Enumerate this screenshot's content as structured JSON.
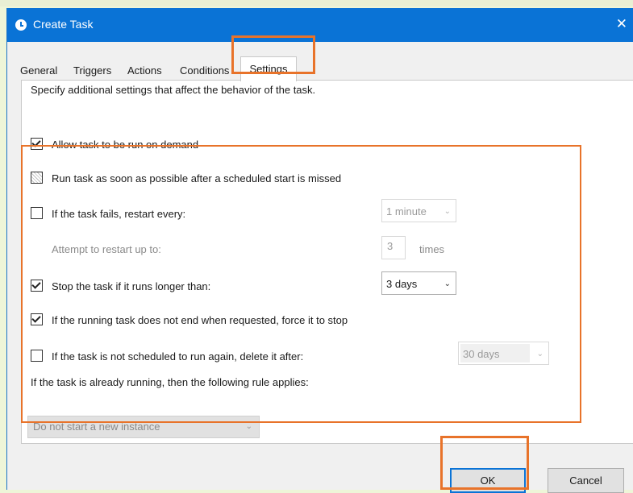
{
  "window": {
    "title": "Create Task",
    "close": "✕"
  },
  "tabs": [
    {
      "label": "General"
    },
    {
      "label": "Triggers"
    },
    {
      "label": "Actions"
    },
    {
      "label": "Conditions"
    },
    {
      "label": "Settings",
      "active": true
    }
  ],
  "settings": {
    "description": "Specify additional settings that affect the behavior of the task.",
    "allow_on_demand": {
      "label": "Allow task to be run on demand",
      "checked": true
    },
    "run_asap": {
      "label": "Run task as soon as possible after a scheduled start is missed",
      "checked": "indeterminate"
    },
    "restart_on_fail": {
      "label": "If the task fails, restart every:",
      "checked": false,
      "interval": "1 minute"
    },
    "restart_attempts": {
      "label": "Attempt to restart up to:",
      "value": "3",
      "unit": "times"
    },
    "stop_if_longer": {
      "label": "Stop the task if it runs longer than:",
      "checked": true,
      "duration": "3 days"
    },
    "force_stop": {
      "label": "If the running task does not end when requested, force it to stop",
      "checked": true
    },
    "delete_after": {
      "label": "If the task is not scheduled to run again, delete it after:",
      "checked": false,
      "duration": "30 days"
    },
    "running_rule": {
      "label": "If the task is already running, then the following rule applies:",
      "value": "Do not start a new instance"
    }
  },
  "buttons": {
    "ok": "OK",
    "cancel": "Cancel"
  },
  "colors": {
    "titlebar": "#0A73D6",
    "highlight": "#E8732A",
    "background": "#EEF5D8"
  }
}
